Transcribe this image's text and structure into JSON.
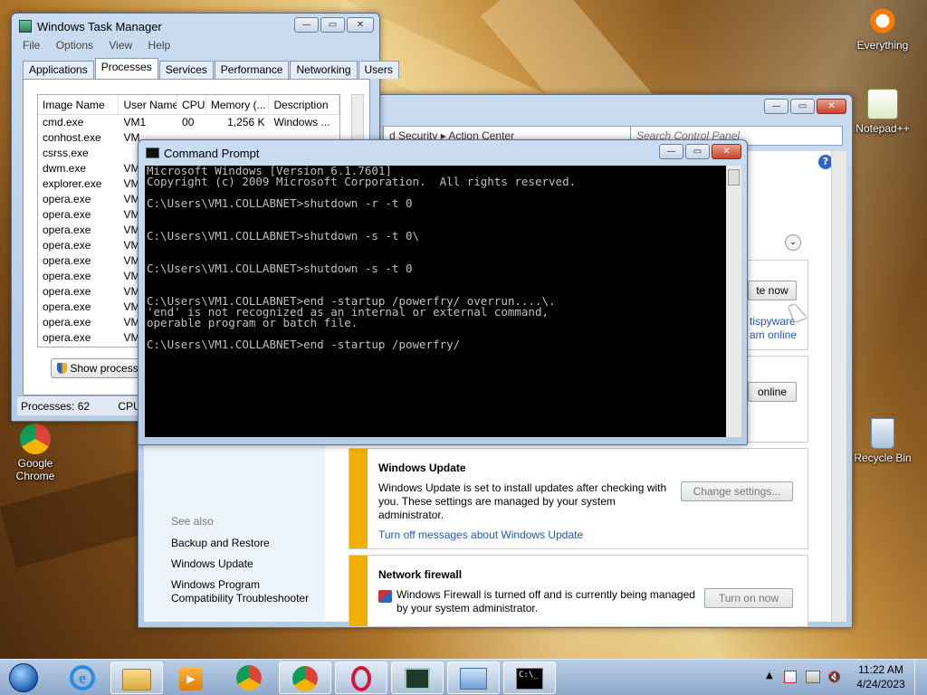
{
  "desktop": {
    "icons": [
      {
        "label": "Everything",
        "icon": "everything-icon"
      },
      {
        "label": "Notepad++",
        "icon": "notepadpp-icon"
      },
      {
        "label": "Recycle Bin",
        "icon": "recycle-bin-icon"
      },
      {
        "label": "Google Chrome",
        "icon": "chrome-icon"
      }
    ]
  },
  "task_manager": {
    "title": "Windows Task Manager",
    "menu": [
      "File",
      "Options",
      "View",
      "Help"
    ],
    "tabs": [
      "Applications",
      "Processes",
      "Services",
      "Performance",
      "Networking",
      "Users"
    ],
    "active_tab": "Processes",
    "columns": [
      "Image Name",
      "User Name",
      "CPU",
      "Memory (...",
      "Description"
    ],
    "rows": [
      {
        "image": "cmd.exe",
        "user": "VM1",
        "cpu": "00",
        "memory": "1,256 K",
        "desc": "Windows ..."
      },
      {
        "image": "conhost.exe",
        "user": "VM"
      },
      {
        "image": "csrss.exe",
        "user": ""
      },
      {
        "image": "dwm.exe",
        "user": "VM"
      },
      {
        "image": "explorer.exe",
        "user": "VM"
      },
      {
        "image": "opera.exe",
        "user": "VM"
      },
      {
        "image": "opera.exe",
        "user": "VM"
      },
      {
        "image": "opera.exe",
        "user": "VM"
      },
      {
        "image": "opera.exe",
        "user": "VM"
      },
      {
        "image": "opera.exe",
        "user": "VM"
      },
      {
        "image": "opera.exe",
        "user": "VM"
      },
      {
        "image": "opera.exe",
        "user": "VM"
      },
      {
        "image": "opera.exe",
        "user": "VM"
      },
      {
        "image": "opera.exe",
        "user": "VM"
      },
      {
        "image": "opera.exe",
        "user": "VM"
      }
    ],
    "show_processes_button": "Show processes f",
    "status_processes": "Processes: 62",
    "status_cpu": "CPU"
  },
  "control_panel": {
    "address": "d Security  ▸  Action Center",
    "search_placeholder": "Search Control Panel",
    "button_fragment_1": "te now",
    "link_fragment_1": "tispyware",
    "link_fragment_2": "am online",
    "button_fragment_2": "online",
    "see_also_heading": "See also",
    "see_also_links": [
      "Backup and Restore",
      "Windows Update",
      "Windows Program Compatibility Troubleshooter"
    ],
    "windows_update": {
      "heading": "Windows Update",
      "body": "Windows Update is set to install updates after checking with you.  These settings are managed by your system administrator.",
      "link": "Turn off messages about Windows Update",
      "button": "Change settings..."
    },
    "network_firewall": {
      "heading": "Network firewall",
      "body": "Windows Firewall is turned off and is currently being managed by your system administrator.",
      "button": "Turn on now"
    }
  },
  "command_prompt": {
    "title": "Command Prompt",
    "lines": [
      "Microsoft Windows [Version 6.1.7601]",
      "Copyright (c) 2009 Microsoft Corporation.  All rights reserved.",
      "",
      "C:\\Users\\VM1.COLLABNET>shutdown -r -t 0",
      "",
      "",
      "C:\\Users\\VM1.COLLABNET>shutdown -s -t 0\\",
      "",
      "",
      "C:\\Users\\VM1.COLLABNET>shutdown -s -t 0",
      "",
      "",
      "C:\\Users\\VM1.COLLABNET>end -startup /powerfry/ overrun....\\.",
      "'end' is not recognized as an internal or external command,",
      "operable program or batch file.",
      "",
      "C:\\Users\\VM1.COLLABNET>end -startup /powerfry/"
    ]
  },
  "taskbar": {
    "clock_time": "11:22 AM",
    "clock_date": "4/24/2023",
    "buttons": [
      "start-orb",
      "internet-explorer",
      "windows-explorer",
      "media-player",
      "chrome",
      "chrome",
      "opera",
      "task-manager",
      "control-panel",
      "command-prompt"
    ]
  },
  "colors": {
    "accent": "#f0b000",
    "link": "#1e5bb5",
    "console_bg": "#000000",
    "console_fg": "#c0c0c0"
  }
}
